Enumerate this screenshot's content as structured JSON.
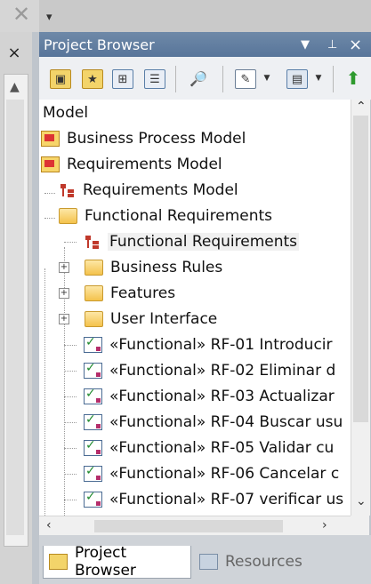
{
  "window": {
    "title": "Project Browser"
  },
  "left_panel": {
    "close_symbol": "×"
  },
  "toolbar": {
    "icons": [
      "new-model-icon",
      "new-package-icon",
      "new-diagram-icon",
      "new-element-icon",
      "find-icon",
      "edit-icon",
      "dropdown-icon",
      "copy-icon",
      "dropdown-icon",
      "move-up-icon"
    ]
  },
  "tree": {
    "items": [
      {
        "label": "Model",
        "icon": "model-icon"
      },
      {
        "label": "Business Process Model",
        "icon": "package-icon"
      },
      {
        "label": "Requirements Model",
        "icon": "package-icon"
      },
      {
        "label": "Requirements Model",
        "icon": "diagram-icon"
      },
      {
        "label": "Functional Requirements",
        "icon": "folder-icon"
      },
      {
        "label": "Functional Requirements",
        "icon": "diagram-icon"
      },
      {
        "label": "Business Rules",
        "icon": "folder-icon",
        "expander": "+"
      },
      {
        "label": "Features",
        "icon": "folder-icon",
        "expander": "+"
      },
      {
        "label": "User Interface",
        "icon": "folder-icon",
        "expander": "+"
      },
      {
        "label": "«Functional» RF-01 Introducir",
        "icon": "requirement-icon"
      },
      {
        "label": "«Functional» RF-02 Eliminar d",
        "icon": "requirement-icon"
      },
      {
        "label": "«Functional» RF-03 Actualizar",
        "icon": "requirement-icon"
      },
      {
        "label": "«Functional» RF-04 Buscar usu",
        "icon": "requirement-icon"
      },
      {
        "label": "«Functional» RF-05 Validar cu",
        "icon": "requirement-icon"
      },
      {
        "label": "«Functional» RF-06 Cancelar c",
        "icon": "requirement-icon"
      },
      {
        "label": "«Functional» RF-07 verificar us",
        "icon": "requirement-icon"
      }
    ]
  },
  "tabs": [
    {
      "label": "Project Browser",
      "active": true
    },
    {
      "label": "Resources",
      "active": false
    }
  ]
}
